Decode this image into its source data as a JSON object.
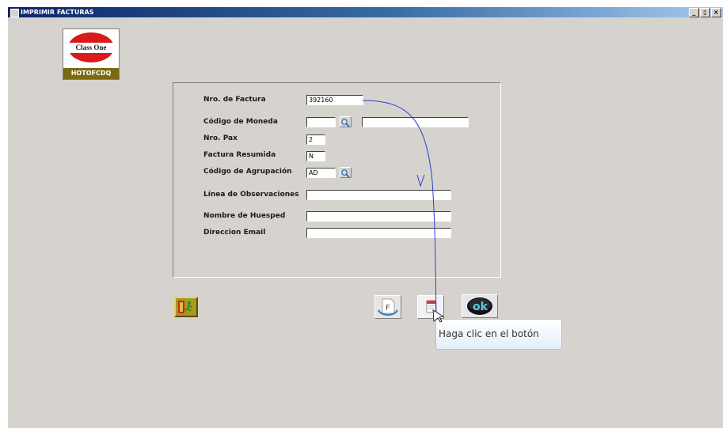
{
  "window": {
    "title": "IMPRIMIR FACTURAS",
    "buttons": [
      "_",
      "▯",
      "×"
    ]
  },
  "logo": {
    "brand": "Class One",
    "code": "HOTOFCDQ"
  },
  "form": {
    "fields": [
      {
        "label": "Nro. de Factura",
        "value": "392160"
      },
      {
        "label": "Código de Moneda",
        "value": "",
        "description": ""
      },
      {
        "label": "Nro. Pax",
        "value": "2"
      },
      {
        "label": "Factura Resumida",
        "value": "N"
      },
      {
        "label": "Código de Agrupación",
        "value": "AD"
      },
      {
        "label": "Línea de Observaciones",
        "value": ""
      },
      {
        "label": "Nombre de Huesped",
        "value": ""
      },
      {
        "label": "Direccion Email",
        "value": ""
      }
    ]
  },
  "toolbar": {
    "format_button_letter": "F",
    "ok_button_label": "ok"
  },
  "tooltip": {
    "text": "Haga clic en el botón"
  },
  "icons": {
    "exit": "exit-door-icon",
    "lookup": "magnifier-icon",
    "format": "format-f-icon",
    "print": "print-document-icon",
    "ok": "ok-icon",
    "cursor": "mouse-pointer-icon"
  },
  "colors": {
    "window_bg": "#d6d3ce",
    "titlebar": "#0a246a",
    "connector": "#2a3fd0",
    "logo_red": "#d71b1b"
  }
}
